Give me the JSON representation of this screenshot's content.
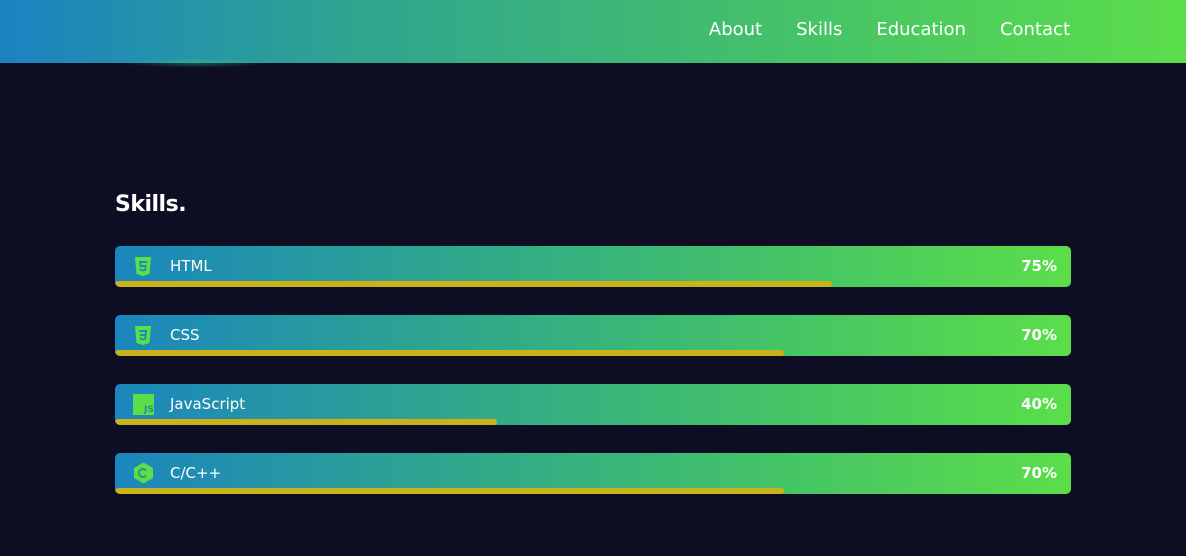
{
  "nav": {
    "items": [
      {
        "label": "About"
      },
      {
        "label": "Skills"
      },
      {
        "label": "Education"
      },
      {
        "label": "Contact"
      }
    ]
  },
  "skills_section": {
    "title": "Skills.",
    "items": [
      {
        "name": "HTML",
        "percent_label": "75%",
        "level": 0.75,
        "icon": "html5-icon"
      },
      {
        "name": "CSS",
        "percent_label": "70%",
        "level": 0.7,
        "icon": "css3-icon"
      },
      {
        "name": "JavaScript",
        "percent_label": "40%",
        "level": 0.4,
        "icon": "javascript-icon"
      },
      {
        "name": "C/C++",
        "percent_label": "70%",
        "level": 0.7,
        "icon": "cplusplus-icon"
      }
    ]
  },
  "colors": {
    "background": "#0d0e24",
    "gradient_start": "#1b82c2",
    "gradient_end": "#5bde4a",
    "progress_bar": "#c9b21a",
    "icon_color": "#5bde4a"
  }
}
